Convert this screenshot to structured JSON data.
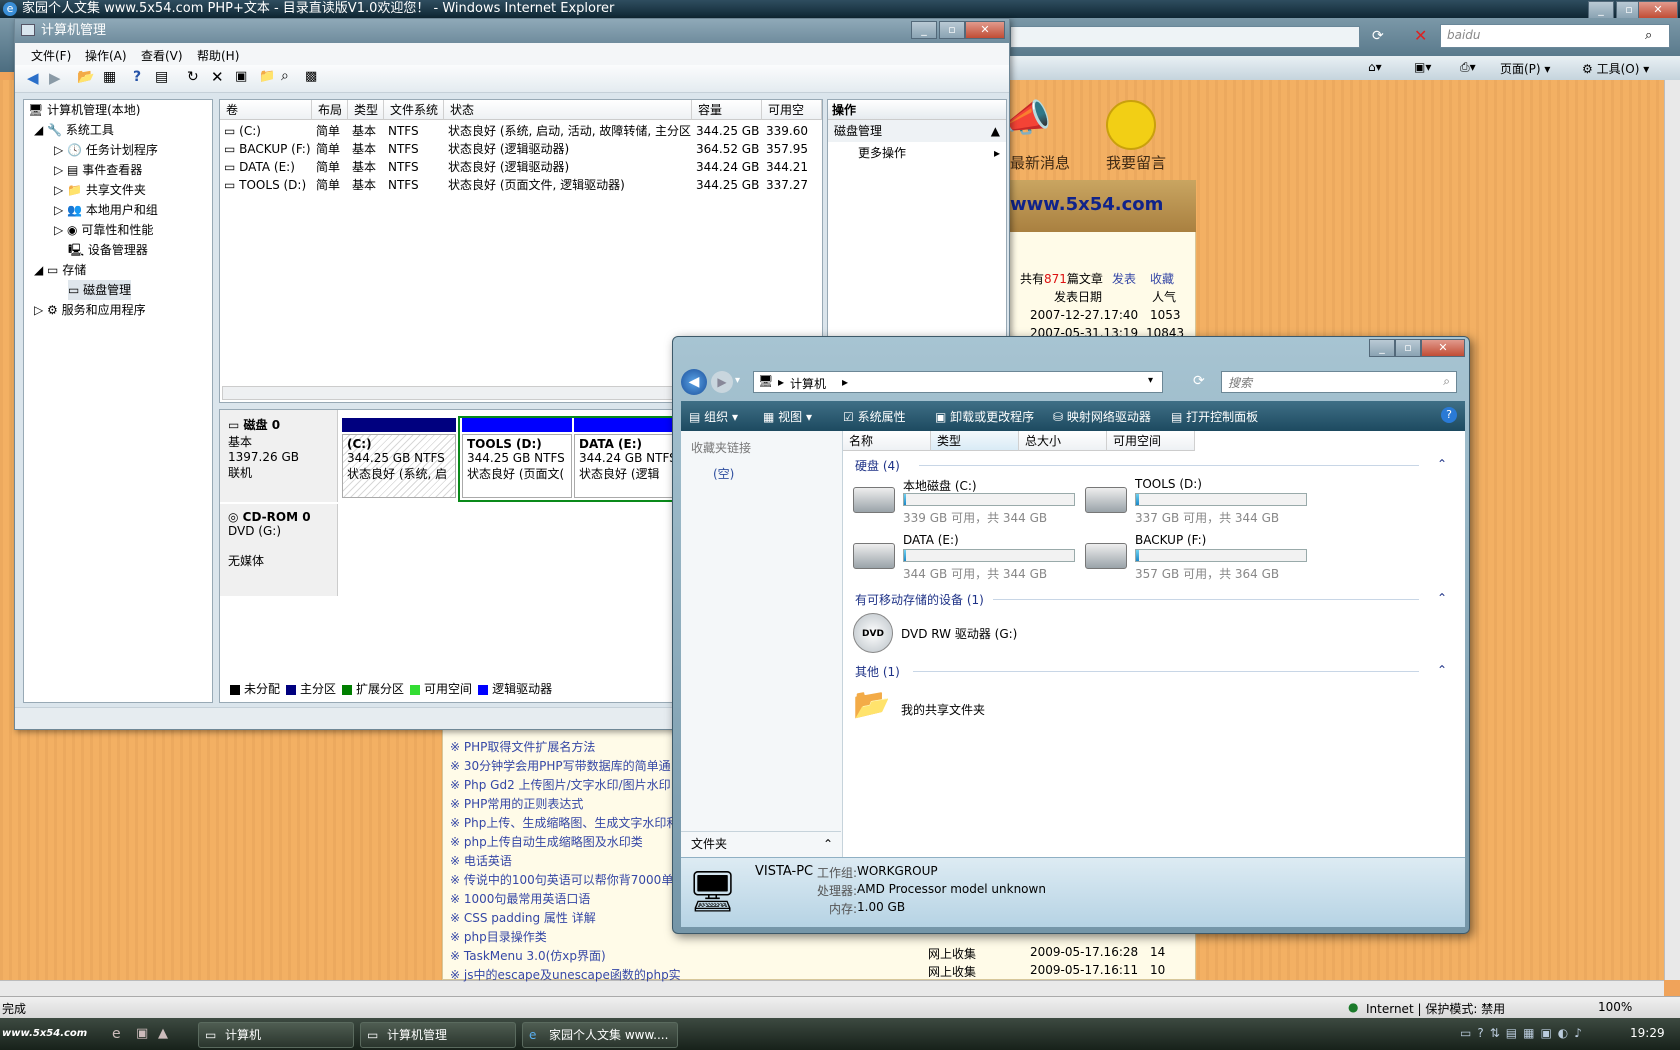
{
  "ie": {
    "title": "家园个人文集 www.5x54.com PHP+文本 - 目录直读版V1.0欢迎您！ - Windows Internet Explorer",
    "search_placeholder": "baidu",
    "cmd_page": "页面(P)",
    "cmd_tools": "工具(O)",
    "status_left": "完成",
    "status_zone": "Internet | 保护模式: 禁用",
    "zoom": "100%"
  },
  "webpage": {
    "nav_news": "最新消息",
    "nav_guestbook": "我要留言",
    "site": "www.5x54.com",
    "count_prefix": "共有",
    "count": "871",
    "count_suffix": "篇文章",
    "publish": "发表",
    "favorite": "收藏",
    "col_date": "发表日期",
    "col_pop": "人气",
    "top_rows": [
      {
        "date": "2007-12-27.17:40",
        "pop": "1053"
      },
      {
        "date": "2007-05-31.13:19",
        "pop": "10843"
      }
    ],
    "articles": [
      "PHP取得文件扩展名方法",
      "30分钟学会用PHP写带数据库的简单通",
      "Php Gd2 上传图片/文字水印/图片水印",
      "PHP常用的正则表达式",
      "Php上传、生成缩略图、生成文字水印和",
      "php上传自动生成缩略图及水印类",
      "电话英语",
      "传说中的100句英语可以帮你背7000单",
      "1000句最常用英语口语",
      "CSS padding 属性 详解",
      "php目录操作类",
      "TaskMenu 3.0(仿xp界面)",
      "js中的escape及unescape函数的php实现"
    ],
    "bottom_rows": [
      {
        "src": "网上收集",
        "date": "2009-05-17.16:28",
        "pop": "14"
      },
      {
        "src": "网上收集",
        "date": "2009-05-17.16:11",
        "pop": "10"
      }
    ]
  },
  "cm": {
    "title": "计算机管理",
    "menu": [
      "文件(F)",
      "操作(A)",
      "查看(V)",
      "帮助(H)"
    ],
    "tree": [
      {
        "label": "计算机管理(本地)",
        "level": 0
      },
      {
        "label": "系统工具",
        "level": 1
      },
      {
        "label": "任务计划程序",
        "level": 2
      },
      {
        "label": "事件查看器",
        "level": 2
      },
      {
        "label": "共享文件夹",
        "level": 2
      },
      {
        "label": "本地用户和组",
        "level": 2
      },
      {
        "label": "可靠性和性能",
        "level": 2
      },
      {
        "label": "设备管理器",
        "level": 2
      },
      {
        "label": "存储",
        "level": 1
      },
      {
        "label": "磁盘管理",
        "level": 2
      },
      {
        "label": "服务和应用程序",
        "level": 1
      }
    ],
    "columns": [
      "卷",
      "布局",
      "类型",
      "文件系统",
      "状态",
      "容量",
      "可用空"
    ],
    "volumes": [
      {
        "name": "(C:)",
        "layout": "简单",
        "type": "基本",
        "fs": "NTFS",
        "status": "状态良好 (系统, 启动, 活动, 故障转储, 主分区)",
        "capacity": "344.25 GB",
        "free": "339.60"
      },
      {
        "name": "BACKUP (F:)",
        "layout": "简单",
        "type": "基本",
        "fs": "NTFS",
        "status": "状态良好 (逻辑驱动器)",
        "capacity": "364.52 GB",
        "free": "357.95"
      },
      {
        "name": "DATA (E:)",
        "layout": "简单",
        "type": "基本",
        "fs": "NTFS",
        "status": "状态良好 (逻辑驱动器)",
        "capacity": "344.24 GB",
        "free": "344.21"
      },
      {
        "name": "TOOLS (D:)",
        "layout": "简单",
        "type": "基本",
        "fs": "NTFS",
        "status": "状态良好 (页面文件, 逻辑驱动器)",
        "capacity": "344.25 GB",
        "free": "337.27"
      }
    ],
    "disk0": {
      "name": "磁盘 0",
      "type": "基本",
      "size": "1397.26 GB",
      "state": "联机"
    },
    "partitions": [
      {
        "name": "(C:)",
        "size": "344.25 GB NTFS",
        "status": "状态良好 (系统, 启"
      },
      {
        "name": "TOOLS (D:)",
        "size": "344.25 GB NTFS",
        "status": "状态良好 (页面文("
      },
      {
        "name": "DATA (E:)",
        "size": "344.24 GB NTFS",
        "status": "状态良好 (逻辑"
      }
    ],
    "cdrom": {
      "name": "CD-ROM 0",
      "type": "DVD (G:)",
      "state": "无媒体"
    },
    "legend": [
      {
        "label": "未分配",
        "color": "#000000"
      },
      {
        "label": "主分区",
        "color": "#00007f"
      },
      {
        "label": "扩展分区",
        "color": "#007f00"
      },
      {
        "label": "可用空间",
        "color": "#33dd33"
      },
      {
        "label": "逻辑驱动器",
        "color": "#0000ff"
      }
    ],
    "actions_title": "操作",
    "actions_section": "磁盘管理",
    "actions_more": "更多操作"
  },
  "explorer": {
    "path": "计算机",
    "search_placeholder": "搜索",
    "cmd": [
      "组织",
      "视图",
      "系统属性",
      "卸载或更改程序",
      "映射网络驱动器",
      "打开控制面板"
    ],
    "fav_links": "收藏夹链接",
    "fav_empty": "(空)",
    "folders": "文件夹",
    "columns": [
      "名称",
      "类型",
      "总大小",
      "可用空间"
    ],
    "group_hdd": "硬盘 (4)",
    "drives": [
      {
        "name": "本地磁盘 (C:)",
        "free_text": "339 GB 可用，共 344 GB",
        "used_frac": 0.014
      },
      {
        "name": "TOOLS (D:)",
        "free_text": "337 GB 可用，共 344 GB",
        "used_frac": 0.02
      },
      {
        "name": "DATA (E:)",
        "free_text": "344 GB 可用，共 344 GB",
        "used_frac": 0.0
      },
      {
        "name": "BACKUP (F:)",
        "free_text": "357 GB 可用，共 364 GB",
        "used_frac": 0.019
      }
    ],
    "group_removable": "有可移动存储的设备 (1)",
    "dvd": "DVD RW 驱动器 (G:)",
    "group_other": "其他 (1)",
    "shared": "我的共享文件夹",
    "pc_name": "VISTA-PC",
    "workgroup_label": "工作组:",
    "workgroup": "WORKGROUP",
    "cpu_label": "处理器:",
    "cpu": "AMD Processor model unknown",
    "mem_label": "内存:",
    "mem": "1.00 GB"
  },
  "taskbar": {
    "buttons": [
      "计算机",
      "计算机管理",
      "家园个人文集 www...."
    ],
    "clock": "19:29",
    "logo_text": "www.5x54.com"
  }
}
